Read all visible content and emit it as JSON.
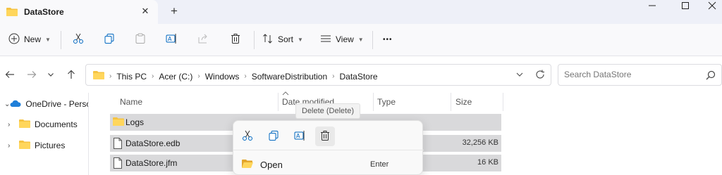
{
  "window": {
    "tab_title": "DataStore",
    "tab_icon": "folder-icon",
    "new_tab_symbol": "+",
    "close_tab_symbol": "✕"
  },
  "toolbar": {
    "new_label": "New",
    "sort_label": "Sort",
    "view_label": "View",
    "more_symbol": "•••",
    "icons": [
      "cut-icon",
      "copy-icon",
      "paste-icon",
      "rename-icon",
      "share-icon",
      "delete-icon"
    ]
  },
  "address": {
    "crumbs": [
      "This PC",
      "Acer (C:)",
      "Windows",
      "SoftwareDistribution",
      "DataStore"
    ]
  },
  "search": {
    "placeholder": "Search DataStore"
  },
  "navpane": {
    "items": [
      {
        "label": "OneDrive - Perso",
        "icon": "onedrive-cloud-icon",
        "expander": "⌄"
      },
      {
        "label": "Documents",
        "icon": "folder-icon",
        "expander": "›"
      },
      {
        "label": "Pictures",
        "icon": "folder-icon",
        "expander": "›"
      }
    ]
  },
  "columns": {
    "name": "Name",
    "date_modified": "Date modified",
    "type": "Type",
    "size": "Size"
  },
  "files": [
    {
      "name": "Logs",
      "kind": "folder",
      "size": ""
    },
    {
      "name": "DataStore.edb",
      "kind": "file",
      "size": "32,256 KB"
    },
    {
      "name": "DataStore.jfm",
      "kind": "file",
      "size": "16 KB"
    }
  ],
  "tooltip": {
    "text": "Delete (Delete)"
  },
  "context_menu": {
    "icons": [
      "cut-icon",
      "copy-icon",
      "rename-icon",
      "delete-icon"
    ],
    "open_label": "Open",
    "open_shortcut": "Enter"
  },
  "colors": {
    "folder": "#f5c342",
    "accent": "#0067c0",
    "selection": "#d9d9db"
  }
}
